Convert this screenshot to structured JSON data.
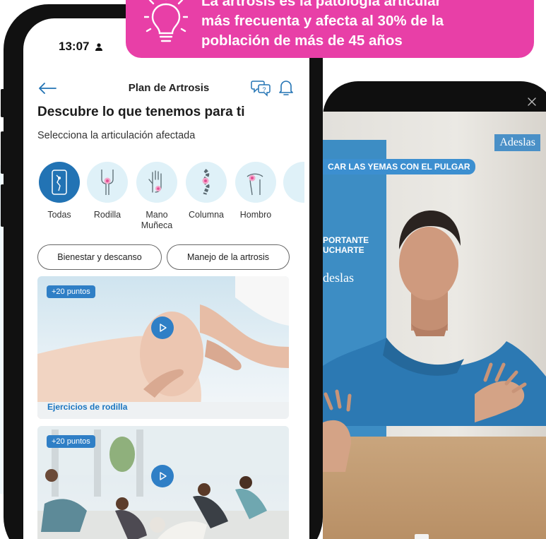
{
  "status": {
    "time": "13:07"
  },
  "header": {
    "title": "Plan de Artrosis"
  },
  "intro": {
    "heading": "Descubre lo que tenemos para ti",
    "subheading": "Selecciona la articulación afectada"
  },
  "joints": [
    {
      "label": "Todas",
      "icon": "skeleton-icon"
    },
    {
      "label": "Rodilla",
      "icon": "knee-icon"
    },
    {
      "label": "Mano\nMuñeca",
      "icon": "hand-icon"
    },
    {
      "label": "Columna",
      "icon": "spine-icon"
    },
    {
      "label": "Hombro",
      "icon": "shoulder-icon"
    }
  ],
  "chips": [
    {
      "label": "Bienestar y descanso"
    },
    {
      "label": "Manejo de la artrosis"
    }
  ],
  "cards": [
    {
      "badge": "+20 puntos",
      "title": "Ejercicios de rodilla"
    },
    {
      "badge": "+20 puntos",
      "title": ""
    }
  ],
  "video": {
    "brand": "Adeslas",
    "caption": "CAR LAS YEMAS CON EL PULGAR",
    "banner_line1": "PORTANTE",
    "banner_line2": "UCHARTE",
    "banner_brand": "deslas"
  },
  "callout": {
    "line1": "La artrosis es la patología articular",
    "line2": "más frecuenta y afecta al 30% de la",
    "line3": "población de más de 45 años"
  },
  "colors": {
    "accent": "#2273b4",
    "callout": "#e83fa7",
    "pale": "#dff1f8"
  }
}
